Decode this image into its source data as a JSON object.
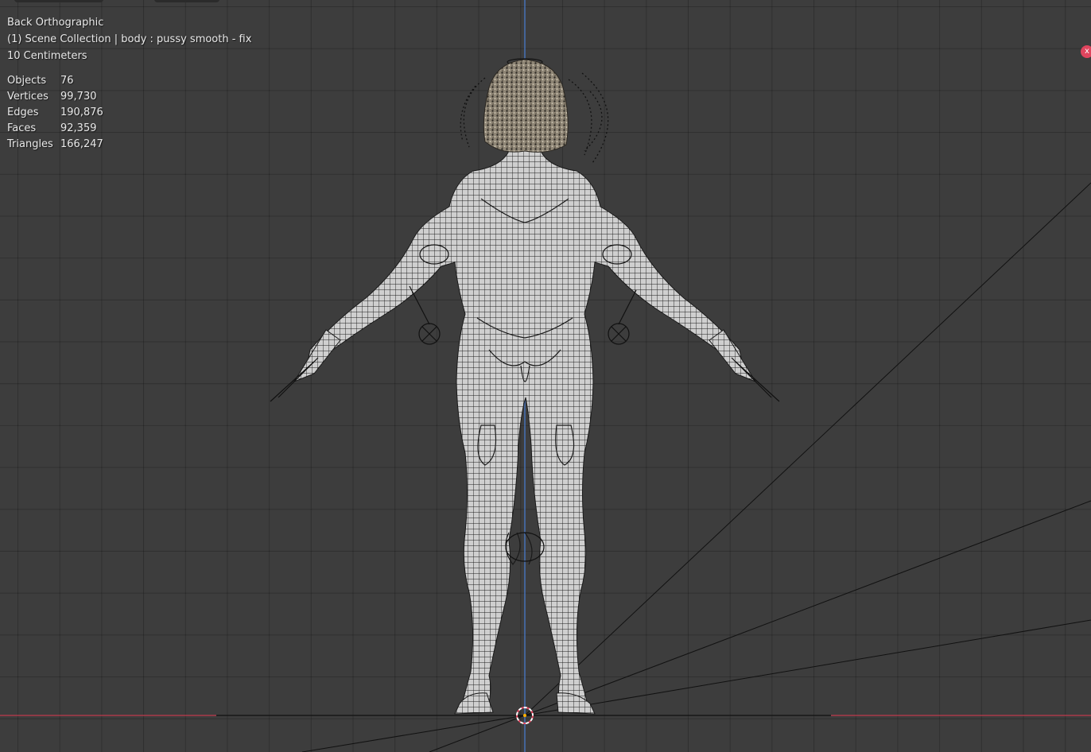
{
  "viewport": {
    "view_name": "Back Orthographic",
    "collection_info": "(1) Scene Collection | body : pussy smooth - fix",
    "scale": "10 Centimeters",
    "badge": "x"
  },
  "stats": [
    {
      "label": "Objects",
      "value": "76"
    },
    {
      "label": "Vertices",
      "value": "99,730"
    },
    {
      "label": "Edges",
      "value": "190,876"
    },
    {
      "label": "Faces",
      "value": "92,359"
    },
    {
      "label": "Triangles",
      "value": "166,247"
    }
  ],
  "colors": {
    "background": "#3d3d3d",
    "z_axis": "#4a7fd4",
    "x_axis": "#c0394b",
    "mesh": "#cfcfcf",
    "wire": "#1a1a1a"
  }
}
